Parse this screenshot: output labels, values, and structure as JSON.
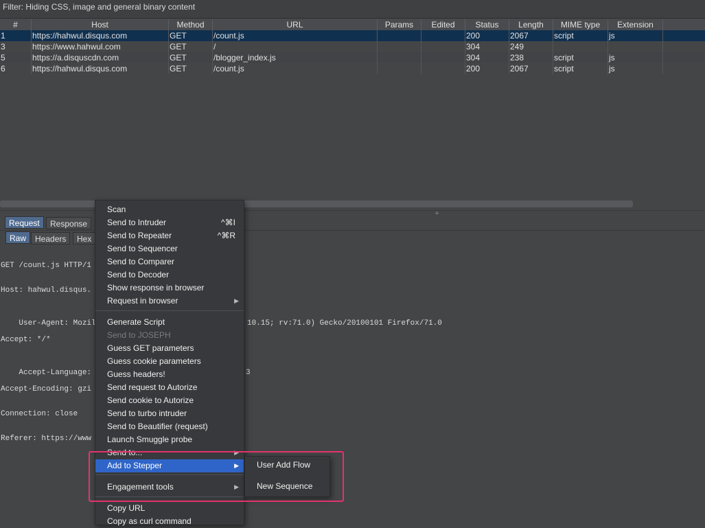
{
  "filter": {
    "text": "Filter: Hiding CSS, image and general binary content"
  },
  "table": {
    "columns": [
      "#",
      "Host",
      "Method",
      "URL",
      "Params",
      "Edited",
      "Status",
      "Length",
      "MIME type",
      "Extension"
    ],
    "rows": [
      {
        "num": "1",
        "host": "https://hahwul.disqus.com",
        "method": "GET",
        "url": "/count.js",
        "params": "",
        "edited": "",
        "status": "200",
        "length": "2067",
        "mime": "script",
        "ext": "js"
      },
      {
        "num": "3",
        "host": "https://www.hahwul.com",
        "method": "GET",
        "url": "/",
        "params": "",
        "edited": "",
        "status": "304",
        "length": "249",
        "mime": "",
        "ext": ""
      },
      {
        "num": "5",
        "host": "https://a.disquscdn.com",
        "method": "GET",
        "url": "/blogger_index.js",
        "params": "",
        "edited": "",
        "status": "304",
        "length": "238",
        "mime": "script",
        "ext": "js"
      },
      {
        "num": "6",
        "host": "https://hahwul.disqus.com",
        "method": "GET",
        "url": "/count.js",
        "params": "",
        "edited": "",
        "status": "200",
        "length": "2067",
        "mime": "script",
        "ext": "js"
      }
    ]
  },
  "tabs": {
    "request": "Request",
    "response": "Response"
  },
  "subtabs": {
    "raw": "Raw",
    "headers": "Headers",
    "hex": "Hex"
  },
  "request_text": {
    "line1": "GET /count.js HTTP/1",
    "line2": "Host: hahwul.disqus.",
    "line3a": "User-Agent: Mozilla/",
    "line3b": "10.15; rv:71.0) Gecko/20100101 Firefox/71.0",
    "line4": "Accept: */*",
    "line5a": "Accept-Language: ko-",
    "line5b": "3",
    "line6": "Accept-Encoding: gzi",
    "line7": "Connection: close",
    "line8": "Referer: https://www"
  },
  "menu": {
    "scan": "Scan",
    "send_intruder": "Send to Intruder",
    "send_intruder_shortcut": "^⌘I",
    "send_repeater": "Send to Repeater",
    "send_repeater_shortcut": "^⌘R",
    "send_sequencer": "Send to Sequencer",
    "send_comparer": "Send to Comparer",
    "send_decoder": "Send to Decoder",
    "show_response": "Show response in browser",
    "request_browser": "Request in browser",
    "generate_script": "Generate Script",
    "send_joseph": "Send to JOSEPH",
    "guess_get": "Guess GET parameters",
    "guess_cookie": "Guess cookie parameters",
    "guess_headers": "Guess headers!",
    "send_request_autorize": "Send request to Autorize",
    "send_cookie_autorize": "Send cookie to Autorize",
    "send_turbo": "Send to turbo intruder",
    "send_beautifier": "Send to Beautifier (request)",
    "launch_smuggle": "Launch Smuggle probe",
    "send_to": "Send to...",
    "add_stepper": "Add to Stepper",
    "engagement_tools": "Engagement tools",
    "copy_url": "Copy URL",
    "copy_curl": "Copy as curl command"
  },
  "submenu": {
    "user_add_flow": "User Add Flow",
    "new_sequence": "New Sequence"
  },
  "icons": {
    "submenu_arrow": "▶",
    "grip": "≡"
  },
  "colors": {
    "highlight": "#2f65c8",
    "selected_row": "#10304f",
    "annotation_box": "#e5336a"
  }
}
